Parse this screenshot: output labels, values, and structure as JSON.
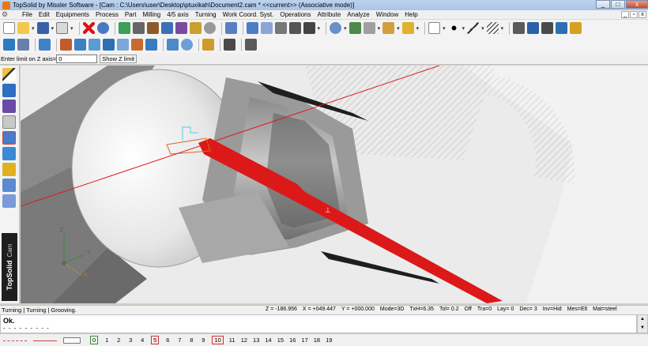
{
  "window": {
    "title": "TopSolid by Missler Software - [Cam : C:\\Users\\user\\Desktop\\ptuxikah\\Document2.cam * <<current>> (Associative mode)]",
    "minimize": "_",
    "maximize": "□",
    "close": "x"
  },
  "menu": {
    "items": [
      "File",
      "Edit",
      "Equipments",
      "Process",
      "Part",
      "Milling",
      "4/5 axis",
      "Turning",
      "Work Coord. Syst.",
      "Operations",
      "Attribute",
      "Analyze",
      "Window",
      "Help"
    ],
    "mdi_min": "_",
    "mdi_restore": "▫",
    "mdi_close": "x"
  },
  "prompt": {
    "label": "Enter limit on Z axis=",
    "value": "0",
    "button": "Show Z limit"
  },
  "brand": {
    "name": "TopSolid",
    "module": "Cam"
  },
  "viewport": {
    "axis_x": "X",
    "axis_y": "Y",
    "axis_z": "Z"
  },
  "status": {
    "left": "Turning | Turning | Grooving.",
    "z": "Z = -186.956",
    "x": "X = +049.447",
    "y": "Y = +000.000",
    "mode": "Mode=3D",
    "txh": "TxH=6.35",
    "tol": "Tol= 0.2",
    "off": "Off",
    "tra": "Tra=0",
    "lay": "Lay= 0",
    "dec": "Dec= 3",
    "inv": "Inv=Hid",
    "mes": "Mes=Elt",
    "mat": "Mat=steel"
  },
  "messages": {
    "line1": "Ok.",
    "line2": "- - - - - - - - -"
  },
  "layers": [
    "0",
    "1",
    "2",
    "3",
    "4",
    "5",
    "6",
    "7",
    "8",
    "9",
    "10",
    "11",
    "12",
    "13",
    "14",
    "15",
    "16",
    "17",
    "18",
    "19"
  ],
  "colors": {
    "tool_red": "#e01a1a",
    "part_grey": "#9e9e9e",
    "brand_bg": "#1e1e1e"
  }
}
